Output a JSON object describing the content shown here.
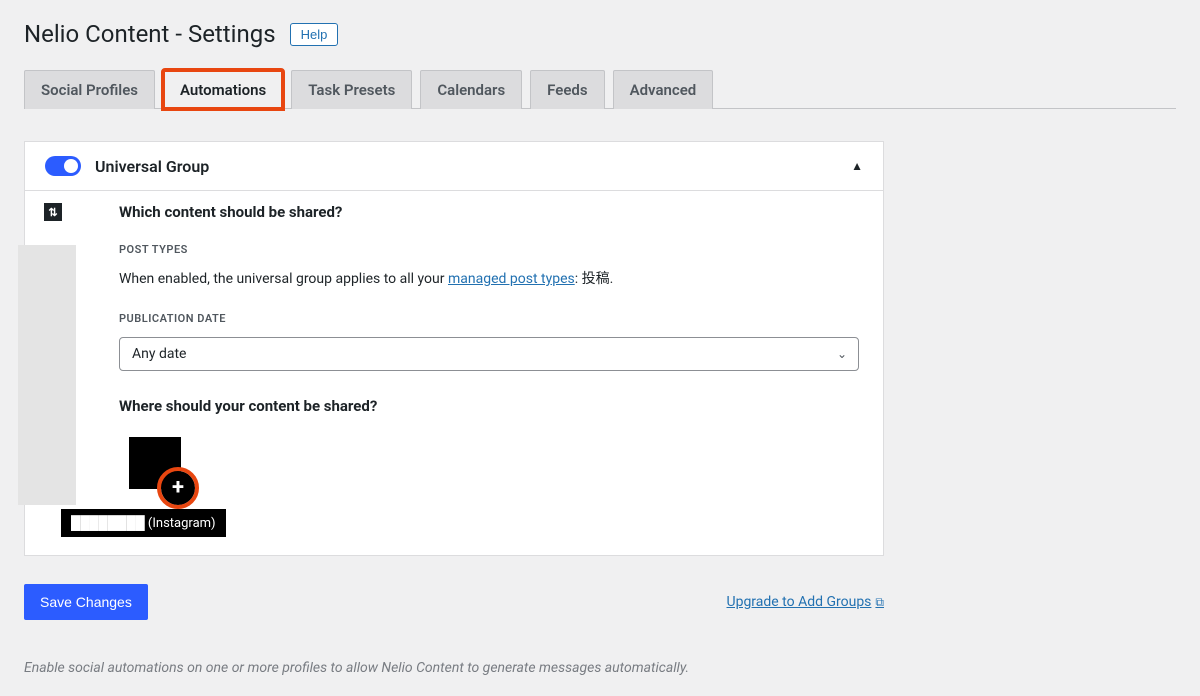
{
  "header": {
    "title": "Nelio Content - Settings",
    "help_label": "Help"
  },
  "tabs": {
    "items": [
      {
        "label": "Social Profiles"
      },
      {
        "label": "Automations"
      },
      {
        "label": "Task Presets"
      },
      {
        "label": "Calendars"
      },
      {
        "label": "Feeds"
      },
      {
        "label": "Advanced"
      }
    ],
    "active_index": 1
  },
  "panel": {
    "title": "Universal Group",
    "section_heading": "Which content should be shared?",
    "post_types_label": "POST TYPES",
    "post_types_prefix": "When enabled, the universal group applies to all your ",
    "post_types_link": "managed post types",
    "post_types_suffix": ": 投稿.",
    "pub_date_label": "PUBLICATION DATE",
    "pub_date_value": "Any date",
    "where_label": "Where should your content be shared?",
    "tooltip_text": "(Instagram)"
  },
  "footer": {
    "save_label": "Save Changes",
    "upgrade_label": "Upgrade to Add Groups",
    "note": "Enable social automations on one or more profiles to allow Nelio Content to generate messages automatically."
  }
}
